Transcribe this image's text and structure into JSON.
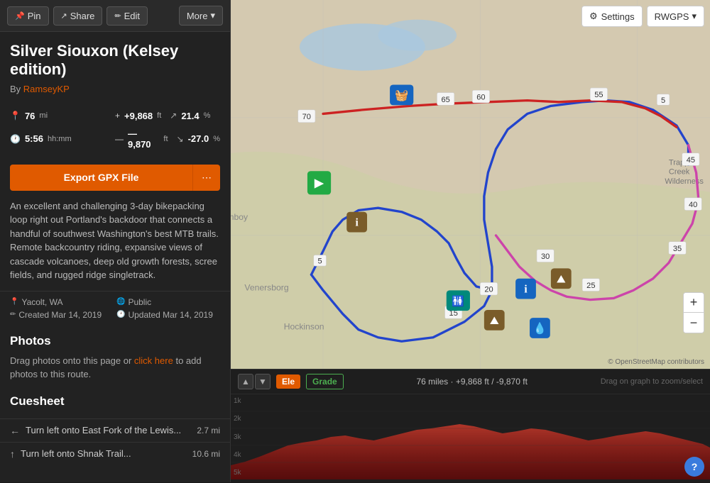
{
  "toolbar": {
    "pin_label": "Pin",
    "share_label": "Share",
    "edit_label": "Edit",
    "more_label": "More"
  },
  "route": {
    "title": "Silver Siouxon (Kelsey edition)",
    "author_prefix": "By",
    "author_name": "RamseyKP",
    "stats": {
      "distance": "76",
      "distance_unit": "mi",
      "elevation_gain": "+9,868",
      "elevation_gain_unit": "ft",
      "elevation_gain_pct": "21.4",
      "elevation_gain_pct_unit": "%",
      "time": "5:56",
      "time_unit": "hh:mm",
      "elevation_loss": "—9,870",
      "elevation_loss_unit": "ft",
      "elevation_loss_pct": "-27.0",
      "elevation_loss_pct_unit": "%"
    },
    "export_btn": "Export GPX File",
    "description": "An excellent and challenging 3-day bikepacking loop right out Portland's backdoor that connects a handful of southwest Washington's best MTB trails. Remote backcountry riding, expansive views of cascade volcanoes, deep old growth forests, scree fields, and rugged ridge singletrack.",
    "location": "Yacolt, WA",
    "visibility": "Public",
    "created": "Created Mar 14, 2019",
    "updated": "Updated Mar 14, 2019"
  },
  "photos": {
    "title": "Photos",
    "drag_text": "Drag photos onto this page or",
    "click_link": "click here",
    "after_text": "to add photos to this route."
  },
  "cuesheet": {
    "title": "Cuesheet",
    "items": [
      {
        "direction": "←",
        "text": "Turn left onto East Fork of the Lewis...",
        "distance": "2.7 mi"
      },
      {
        "direction": "↑",
        "text": "Turn left onto Shnak Trail...",
        "distance": "10.6 mi"
      }
    ]
  },
  "map": {
    "settings_label": "Settings",
    "rwgps_label": "RWGPS",
    "attribution": "© OpenStreetMap contributors"
  },
  "elevation": {
    "up_arrow": "▲",
    "down_arrow": "▼",
    "ele_label": "Ele",
    "grade_label": "Grade",
    "stats_text": "76 miles · +9,868 ft / -9,870 ft",
    "drag_hint": "Drag on graph to zoom/select",
    "y_labels": [
      "5k",
      "4k",
      "3k",
      "2k",
      "1k"
    ],
    "help_icon": "?"
  }
}
